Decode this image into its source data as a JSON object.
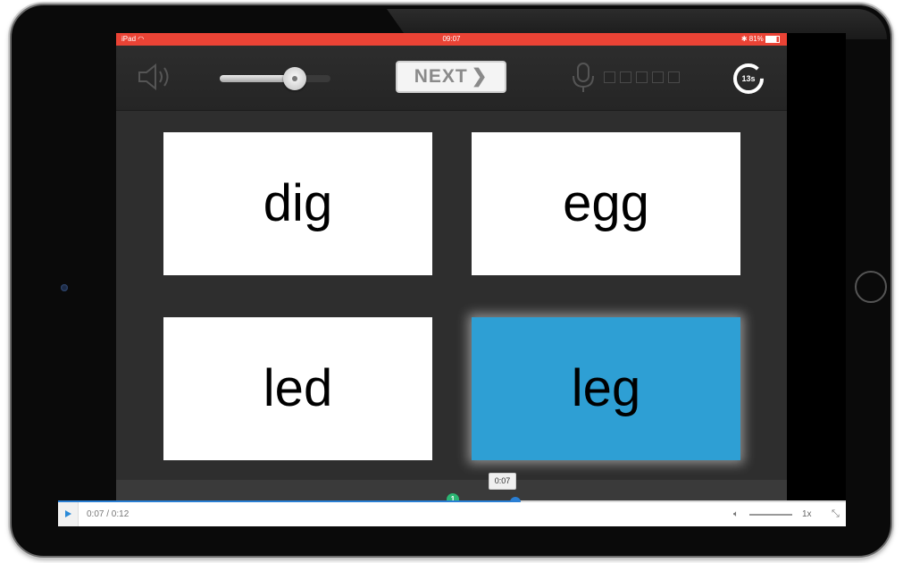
{
  "status_bar": {
    "device": "iPad",
    "wifi_icon": "wifi-icon",
    "time": "09:07",
    "battery": "81%"
  },
  "toolbar": {
    "speaker_icon": "speaker-icon",
    "volume_level": 0.68,
    "next_label": "NEXT",
    "next_icon": "chevron-right-icon",
    "mic_icon": "microphone-icon",
    "level_boxes": 5,
    "timer_label": "13s"
  },
  "cards": [
    {
      "word": "dig",
      "selected": false
    },
    {
      "word": "egg",
      "selected": false
    },
    {
      "word": "led",
      "selected": false
    },
    {
      "word": "leg",
      "selected": true
    }
  ],
  "player": {
    "tooltip_time": "0:07",
    "current_time": "0:07",
    "separator": "/",
    "duration": "0:12",
    "time_display": "0:07 / 0:12",
    "progress": 0.58,
    "marker_label": "1",
    "speed": "1x",
    "volume_icon": "volume-icon",
    "fullscreen_icon": "fullscreen-exit-icon"
  },
  "colors": {
    "status_bar": "#ea4335",
    "selected_card": "#2e9fd4",
    "progress": "#2a7fd4",
    "marker": "#2bb673"
  }
}
